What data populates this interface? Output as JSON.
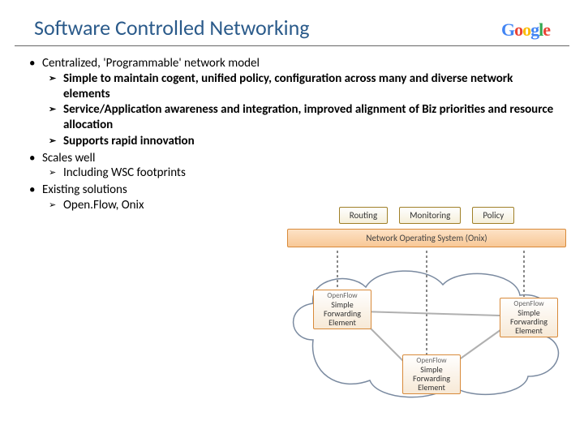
{
  "title": "Software Controlled Networking",
  "logo": {
    "g1": "G",
    "o1": "o",
    "o2": "o",
    "g2": "g",
    "l": "l",
    "e": "e"
  },
  "bullets": {
    "b1": "Centralized, 'Programmable' network model",
    "b1s1": "Simple to maintain cogent, unified policy, configuration across many and diverse network elements",
    "b1s2": "Service/Application awareness and integration, improved alignment of Biz priorities and resource allocation",
    "b1s3": "Supports rapid innovation",
    "b2": "Scales well",
    "b2s1": "Including WSC footprints",
    "b3": "Existing solutions",
    "b3s1": "Open.Flow, Onix"
  },
  "diagram": {
    "routing": "Routing",
    "monitoring": "Monitoring",
    "policy": "Policy",
    "nos": "Network Operating System (Onix)",
    "openflow": "OpenFlow",
    "sfe_l1": "Simple",
    "sfe_l2": "Forwarding",
    "sfe_l3": "Element"
  }
}
